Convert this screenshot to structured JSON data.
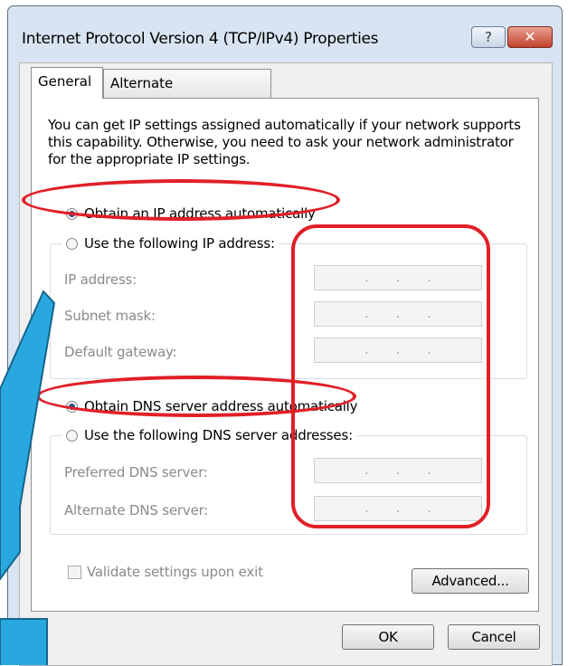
{
  "window": {
    "title": "Internet Protocol Version 4 (TCP/IPv4) Properties",
    "help_label": "?",
    "close_label": "✕"
  },
  "tabs": [
    {
      "label": "General",
      "active": true
    },
    {
      "label": "Alternate Configuration",
      "active": false
    }
  ],
  "general": {
    "description": "You can get IP settings assigned automatically if your network supports this capability. Otherwise, you need to ask your network administrator for the appropriate IP settings.",
    "ip_auto_label": "Obtain an IP address automatically",
    "ip_manual_label": "Use the following IP address:",
    "ip_fields": [
      {
        "label": "IP address:",
        "value": ". . ."
      },
      {
        "label": "Subnet mask:",
        "value": ". . ."
      },
      {
        "label": "Default gateway:",
        "value": ". . ."
      }
    ],
    "dns_auto_label": "Obtain DNS server address automatically",
    "dns_manual_label": "Use the following DNS server addresses:",
    "dns_fields": [
      {
        "label": "Preferred DNS server:",
        "value": ". . ."
      },
      {
        "label": "Alternate DNS server:",
        "value": ". . ."
      }
    ],
    "validate_label": "Validate settings upon exit",
    "advanced_label": "Advanced..."
  },
  "buttons": {
    "ok_label": "OK",
    "cancel_label": "Cancel"
  },
  "annotation": {
    "highlight_color": "#e11f27",
    "callout_color": "#29a8e0"
  }
}
